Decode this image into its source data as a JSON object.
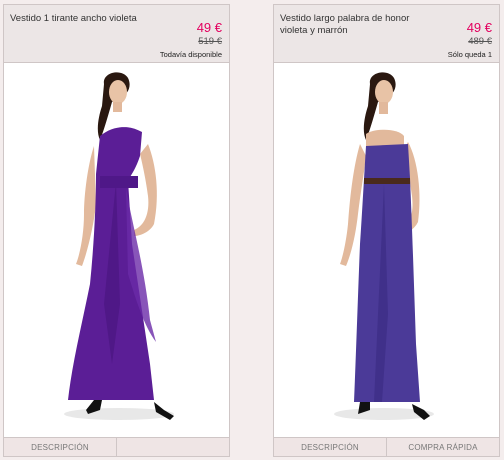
{
  "products": [
    {
      "title": "Vestido 1 tirante ancho violeta",
      "price": "49 €",
      "old_price": "519 €",
      "stock": "Todavía disponible",
      "buttons": [
        "DESCRIPCIÓN",
        ""
      ]
    },
    {
      "title": "Vestido largo palabra de honor violeta y marrón",
      "price": "49 €",
      "old_price": "489 €",
      "stock": "Sólo queda 1",
      "buttons": [
        "DESCRIPCIÓN",
        "COMPRA RÁPIDA"
      ]
    }
  ],
  "colors": {
    "price": "#e3005f",
    "dress1": "#5b1e96",
    "dress2": "#4b3a98",
    "belt": "#4a2a1c"
  }
}
